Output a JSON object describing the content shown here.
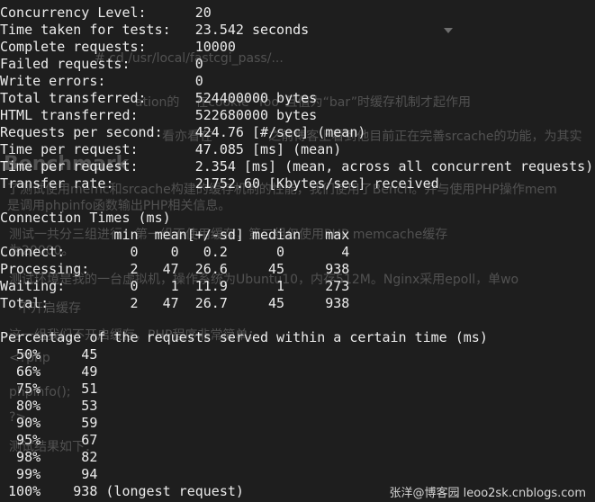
{
  "terminal": {
    "lines": [
      "Concurrency Level:      20",
      "Time taken for tests:   23.542 seconds",
      "Complete requests:      10000",
      "Failed requests:        0",
      "Write errors:           0",
      "Total transferred:      524400000 bytes",
      "HTML transferred:       522680000 bytes",
      "Requests per second:    424.76 [#/sec] (mean)",
      "Time per request:       47.085 [ms] (mean)",
      "Time per request:       2.354 [ms] (mean, across all concurrent requests)",
      "Transfer rate:          21752.60 [Kbytes/sec] received",
      "",
      "Connection Times (ms)",
      "              min  mean[+/-sd] median   max",
      "Connect:        0    0   0.2      0       4",
      "Processing:     2   47  26.6     45     938",
      "Waiting:        0    1  11.9      1     273",
      "Total:          2   47  26.7     45     938",
      "",
      "Percentage of the requests served within a certain time (ms)",
      "  50%     45",
      "  66%     49",
      "  75%     51",
      "  80%     53",
      "  90%     59",
      "  95%     67",
      "  98%     82",
      "  99%     94",
      " 100%    938 (longest request)"
    ]
  },
  "ghost": {
    "path": "# cd /usr/local/fastcgi_pass/...",
    "line1": "ation的    在cookie “foo”且值为“bar”时缓存机制才起作用",
    "line2": "看亦看在              之前博客上看到他目前正在完善srcache的功能，为其实",
    "heading": "Benchmark",
    "line3a": "了测试使用memc和srcache构建的缓存机制的性能，我们使用了Bench。并与使用PHP操作mem",
    "line3b": "是调用phpinfo函数输出PHP相关信息。",
    "line4": "测试一共分三组进行：第一组不使用缓存，第二组仅使用PHP memcache缓存",
    "line5": "为20000。",
    "line6": "测试环境是我的一台虚拟机，操作系统为Ubuntu10，内存512M。Nginx采用epoll，单wo",
    "line7": "不开启缓存",
    "line8": "这一组我们不开启缓存，PHP程序非常简单：",
    "line9": "<?php",
    "line10": "phpinfo();",
    "line11": "?>",
    "line12": "测试结果如下："
  },
  "watermark": "张洋@博客园 leoo2sk.cnblogs.com"
}
